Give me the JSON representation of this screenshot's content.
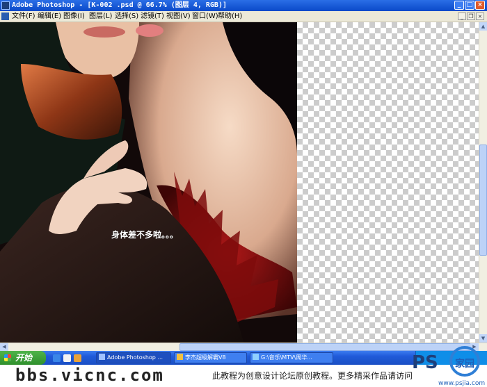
{
  "window": {
    "title": "Adobe Photoshop - [K-002 .psd @ 66.7% (图层 4, RGB)]",
    "controls": {
      "minimize": "_",
      "maximize": "□",
      "close": "×"
    }
  },
  "menu": {
    "items": [
      "文件(F)",
      "编辑(E)",
      "图像(I)",
      "图层(L)",
      "选择(S)",
      "滤镜(T)",
      "视图(V)",
      "窗口(W)",
      "帮助(H)"
    ],
    "doc_controls": {
      "minimize": "_",
      "restore": "❐",
      "close": "×"
    }
  },
  "canvas": {
    "caption": "身体差不多啦。。。"
  },
  "taskbar": {
    "start_label": "开始",
    "tasks": [
      {
        "label": "Adobe Photoshop ..."
      },
      {
        "label": "李杰超级解霸V8"
      },
      {
        "label": "G:\\音乐\\MTV\\周华..."
      }
    ]
  },
  "footer": {
    "site": "bbs.vicnc.com",
    "note": "此教程为创意设计论坛原创教程。更多精采作品请访问",
    "logo_text": "PS",
    "logo_sub": "家园",
    "logo_url": "www.psjia.com"
  },
  "colors": {
    "titlebar": "#0a49c9",
    "taskbar": "#1f5ad8",
    "start": "#2f8f2c",
    "menu_bg": "#ece9d8"
  }
}
